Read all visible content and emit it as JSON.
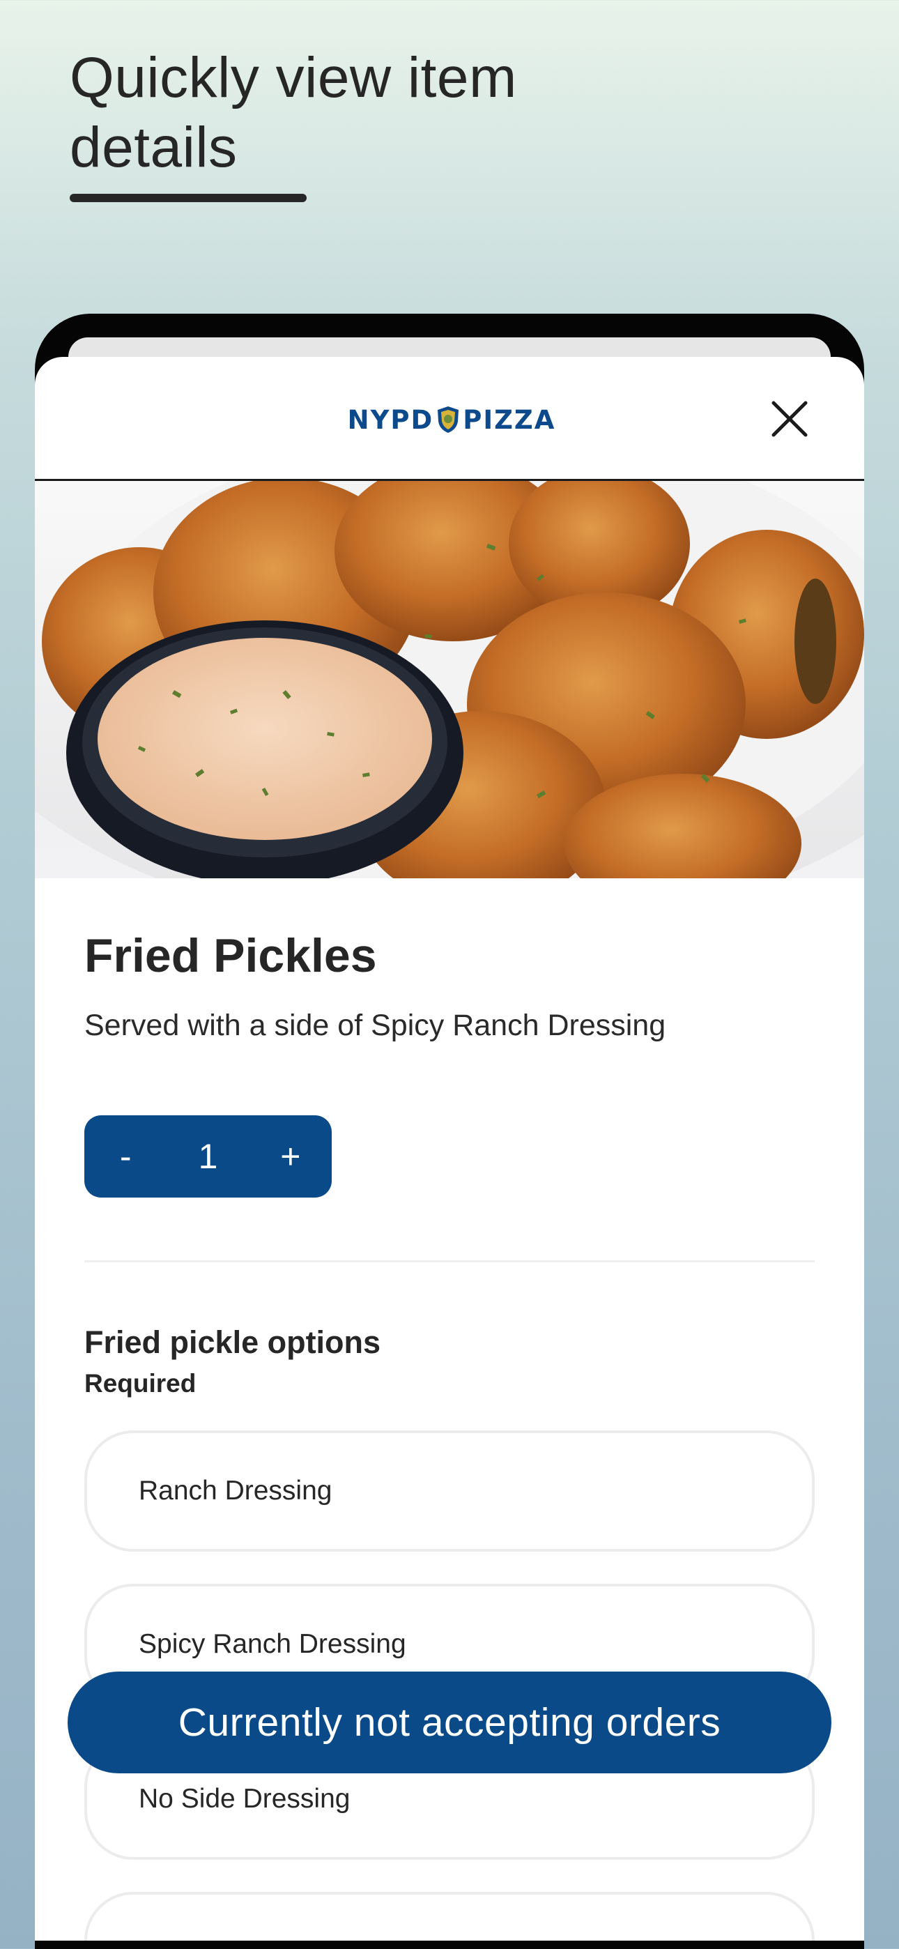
{
  "promo": {
    "headline_line1": "Quickly view item",
    "headline_line2": "details"
  },
  "header": {
    "logo_left": "NYPD",
    "logo_right": "PIZZA"
  },
  "item": {
    "name": "Fried Pickles",
    "description": "Served with a side of Spicy Ranch Dressing"
  },
  "quantity": {
    "minus": "-",
    "value": "1",
    "plus": "+"
  },
  "options_group": {
    "title": "Fried pickle options",
    "requirement": "Required",
    "choices": [
      "Ranch Dressing",
      "Spicy Ranch Dressing",
      "No Side Dressing",
      ""
    ]
  },
  "cta": {
    "label": "Currently not accepting orders"
  },
  "colors": {
    "brand_blue": "#0b4a89",
    "text_dark": "#262626"
  }
}
